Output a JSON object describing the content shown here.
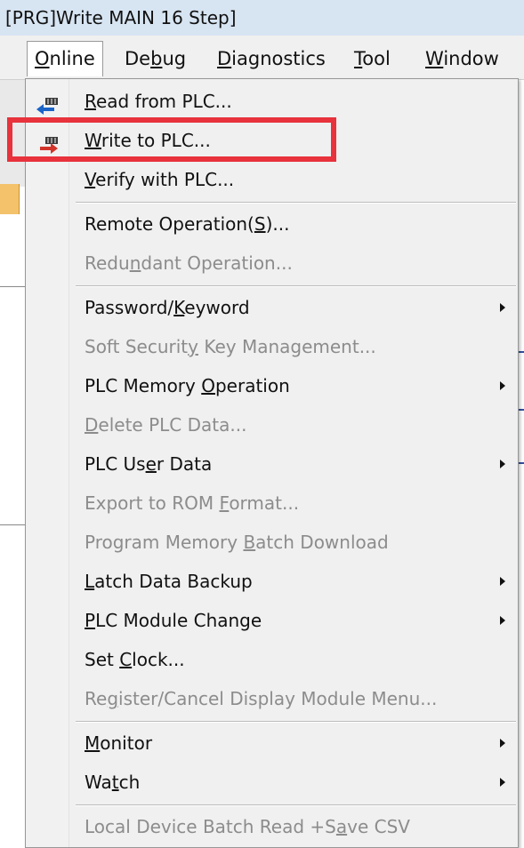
{
  "window": {
    "title": "[PRG]Write MAIN 16 Step]"
  },
  "menubar": {
    "items": [
      {
        "pre": "",
        "u": "O",
        "post": "nline"
      },
      {
        "pre": "De",
        "u": "b",
        "post": "ug"
      },
      {
        "pre": "",
        "u": "D",
        "post": "iagnostics"
      },
      {
        "pre": "",
        "u": "T",
        "post": "ool"
      },
      {
        "pre": "",
        "u": "W",
        "post": "indow"
      }
    ]
  },
  "online_menu": {
    "items": [
      {
        "pre": "",
        "u": "R",
        "post": "ead from PLC...",
        "enabled": true,
        "icon": "read-from-plc-icon"
      },
      {
        "pre": "",
        "u": "W",
        "post": "rite to PLC...",
        "enabled": true,
        "icon": "write-to-plc-icon"
      },
      {
        "pre": "",
        "u": "V",
        "post": "erify with PLC...",
        "enabled": true
      },
      {
        "pre": "Remote Operation(",
        "u": "S",
        "post": ")...",
        "enabled": true
      },
      {
        "pre": "Redu",
        "u": "n",
        "post": "dant Operation...",
        "enabled": false
      },
      {
        "pre": "Password/",
        "u": "K",
        "post": "eyword",
        "enabled": true,
        "submenu": true
      },
      {
        "pre": "Soft Securit",
        "u": "y",
        "post": " Key Management...",
        "enabled": false
      },
      {
        "pre": "PLC Memory ",
        "u": "O",
        "post": "peration",
        "enabled": true,
        "submenu": true
      },
      {
        "pre": "",
        "u": "D",
        "post": "elete PLC Data...",
        "enabled": false
      },
      {
        "pre": "PLC Us",
        "u": "e",
        "post": "r Data",
        "enabled": true,
        "submenu": true
      },
      {
        "pre": "Export to ROM ",
        "u": "F",
        "post": "ormat...",
        "enabled": false
      },
      {
        "pre": "Program Memory ",
        "u": "B",
        "post": "atch Download",
        "enabled": false
      },
      {
        "pre": "",
        "u": "L",
        "post": "atch Data Backup",
        "enabled": true,
        "submenu": true
      },
      {
        "pre": "",
        "u": "P",
        "post": "LC Module Change",
        "enabled": true,
        "submenu": true
      },
      {
        "pre": "Set ",
        "u": "C",
        "post": "lock...",
        "enabled": true
      },
      {
        "pre": "Re",
        "u": "g",
        "post": "ister/Cancel Display Module Menu...",
        "enabled": false
      },
      {
        "pre": "",
        "u": "M",
        "post": "onitor",
        "enabled": true,
        "submenu": true
      },
      {
        "pre": "Wa",
        "u": "t",
        "post": "ch",
        "enabled": true,
        "submenu": true
      },
      {
        "pre": "Local Device Batch Read +S",
        "u": "a",
        "post": "ve CSV",
        "enabled": false
      }
    ]
  },
  "annotation": {
    "highlight_color": "#e8323c"
  }
}
